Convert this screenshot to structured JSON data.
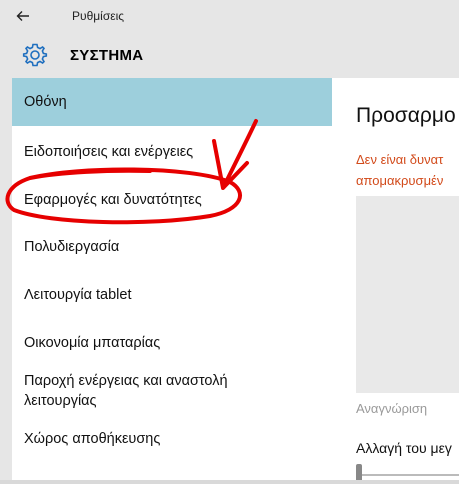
{
  "window": {
    "title": "Ρυθμίσεις"
  },
  "header": {
    "title": "ΣΥΣΤΗΜΑ"
  },
  "sidebar": {
    "items": [
      {
        "label": "Οθόνη",
        "selected": true
      },
      {
        "label": "Ειδοποιήσεις και ενέργειες"
      },
      {
        "label": "Εφαρμογές και δυνατότητες"
      },
      {
        "label": "Πολυδιεργασία"
      },
      {
        "label": "Λειτουργία tablet"
      },
      {
        "label": "Οικονομία μπαταρίας"
      },
      {
        "label": "Παροχή ενέργειας και αναστολή λειτουργίας"
      },
      {
        "label": "Χώρος αποθήκευσης"
      }
    ]
  },
  "content": {
    "title": "Προσαρμο",
    "warning_line1": "Δεν είναι δυνατ",
    "warning_line2": "απομακρυσμέν",
    "identify_link": "Αναγνώριση",
    "scale_label": "Αλλαγή του μεγ"
  },
  "colors": {
    "selected_bg": "#9dcfdc",
    "warning_text": "#d24a1a",
    "annotation_red": "#e60000",
    "accent_icon": "#1f6fbf"
  },
  "icons": {
    "back": "back-arrow-icon",
    "settings": "gear-icon"
  }
}
